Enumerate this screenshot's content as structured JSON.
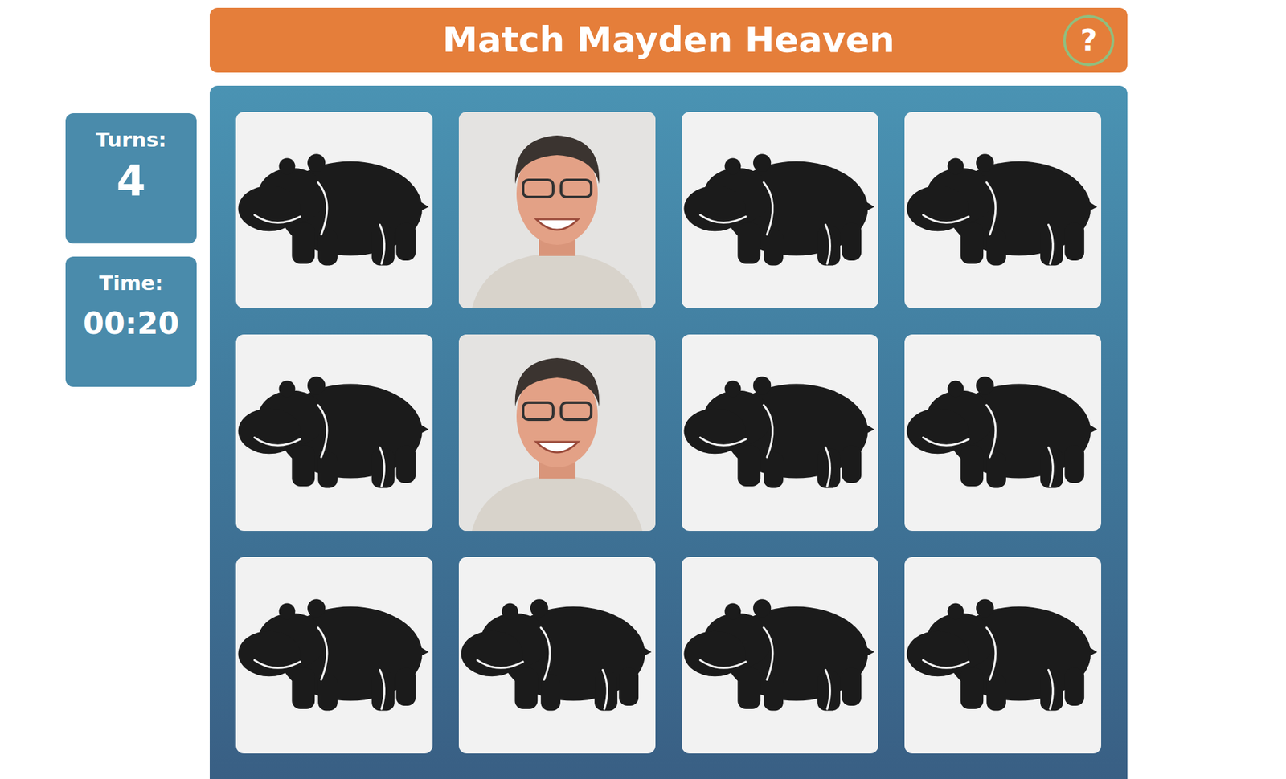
{
  "title": "Match Mayden Heaven",
  "help": {
    "label": "?"
  },
  "stats": [
    {
      "label": "Turns:",
      "value": "4"
    },
    {
      "label": "Time:",
      "value": "00:20"
    }
  ],
  "cards": [
    {
      "face_up": false
    },
    {
      "face_up": true
    },
    {
      "face_up": false
    },
    {
      "face_up": false
    },
    {
      "face_up": false
    },
    {
      "face_up": true
    },
    {
      "face_up": false
    },
    {
      "face_up": false
    },
    {
      "face_up": false
    },
    {
      "face_up": false
    },
    {
      "face_up": false
    },
    {
      "face_up": false
    }
  ]
}
